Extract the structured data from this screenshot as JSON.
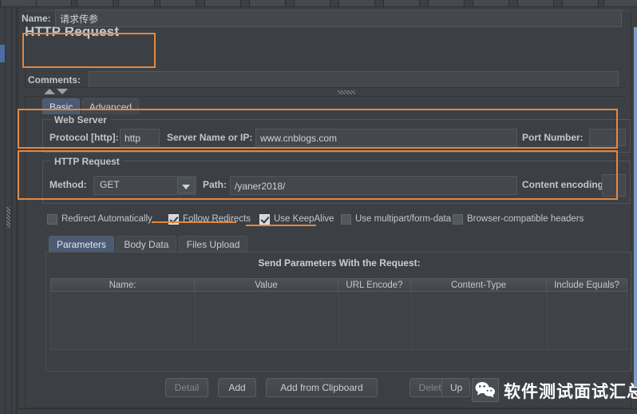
{
  "window": {
    "title": "HTTP Request"
  },
  "fields": {
    "name_label": "Name:",
    "name_value": "请求传参",
    "comments_label": "Comments:",
    "comments_value": ""
  },
  "main_tabs": [
    {
      "label": "Basic",
      "selected": true
    },
    {
      "label": "Advanced",
      "selected": false
    }
  ],
  "web_server": {
    "group_title": "Web Server",
    "protocol_label": "Protocol [http]:",
    "protocol_value": "http",
    "server_label": "Server Name or IP:",
    "server_value": "www.cnblogs.com",
    "port_label": "Port Number:",
    "port_value": ""
  },
  "http_request": {
    "group_title": "HTTP Request",
    "method_label": "Method:",
    "method_value": "GET",
    "path_label": "Path:",
    "path_value": "/yaner2018/",
    "content_encoding_label": "Content encoding:",
    "content_encoding_value": ""
  },
  "checkboxes": [
    {
      "label": "Redirect Automatically",
      "checked": false,
      "highlighted": false
    },
    {
      "label": "Follow Redirects",
      "checked": true,
      "highlighted": true
    },
    {
      "label": "Use KeepAlive",
      "checked": true,
      "highlighted": true
    },
    {
      "label": "Use multipart/form-data",
      "checked": false,
      "highlighted": false
    },
    {
      "label": "Browser-compatible headers",
      "checked": false,
      "highlighted": false
    }
  ],
  "param_tabs": [
    {
      "label": "Parameters",
      "selected": true
    },
    {
      "label": "Body Data",
      "selected": false
    },
    {
      "label": "Files Upload",
      "selected": false
    }
  ],
  "parameters_table": {
    "caption": "Send Parameters With the Request:",
    "columns": [
      "Name:",
      "Value",
      "URL Encode?",
      "Content-Type",
      "Include Equals?"
    ],
    "rows": []
  },
  "buttons": [
    {
      "label": "Detail",
      "enabled": false
    },
    {
      "label": "Add",
      "enabled": true
    },
    {
      "label": "Add from Clipboard",
      "enabled": true
    },
    {
      "label": "Delete",
      "enabled": false
    },
    {
      "label": "Up",
      "enabled": true
    }
  ],
  "watermark": {
    "icon": "wechat-icon",
    "text": "软件测试面试汇总"
  },
  "colors": {
    "highlight": "#e08844",
    "tab_selected": "#4b5b74",
    "panel_bg": "#3c4044",
    "field_bg": "#44484c"
  }
}
